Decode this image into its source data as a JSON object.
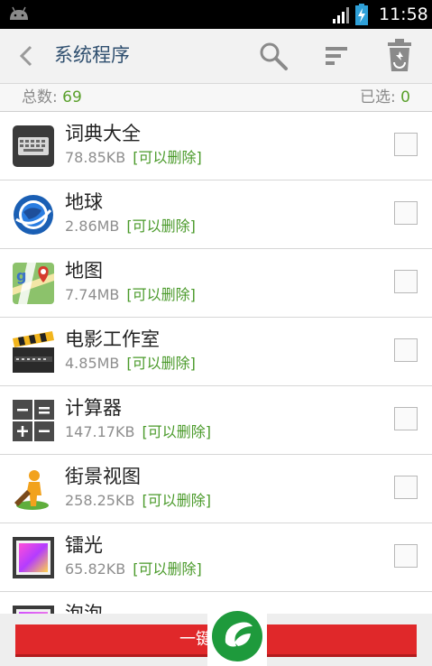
{
  "status_bar": {
    "time": "11:58",
    "left_icon": "android-icon",
    "signal_icon": "signal-icon",
    "battery_icon": "battery-charging-icon"
  },
  "header": {
    "title": "系统程序",
    "icons": [
      "back-icon",
      "search-icon",
      "sort-icon",
      "recycle-bin-icon"
    ]
  },
  "summary": {
    "total_label": "总数:",
    "total_value": "69",
    "selected_label": "已选:",
    "selected_value": "0"
  },
  "apps": [
    {
      "name": "词典大全",
      "size": "78.85KB",
      "tag": "[可以删除]",
      "icon": "keyboard-icon"
    },
    {
      "name": "地球",
      "size": "2.86MB",
      "tag": "[可以删除]",
      "icon": "google-earth-icon"
    },
    {
      "name": "地图",
      "size": "7.74MB",
      "tag": "[可以删除]",
      "icon": "maps-icon"
    },
    {
      "name": "电影工作室",
      "size": "4.85MB",
      "tag": "[可以删除]",
      "icon": "clapperboard-icon"
    },
    {
      "name": "计算器",
      "size": "147.17KB",
      "tag": "[可以删除]",
      "icon": "calculator-icon"
    },
    {
      "name": "街景视图",
      "size": "258.25KB",
      "tag": "[可以删除]",
      "icon": "street-view-icon"
    },
    {
      "name": "镭光",
      "size": "65.82KB",
      "tag": "[可以删除]",
      "icon": "gallery-icon"
    },
    {
      "name": "泡泡",
      "size": "",
      "tag": "",
      "icon": "gallery-icon"
    }
  ],
  "bottom": {
    "button_label": "一键",
    "watermark_icon": "leaf-logo-icon"
  },
  "colors": {
    "action_bar": "#f2f2f2",
    "accent_green": "#5aa02c",
    "button_red": "#e0282a",
    "title_text": "#2f4f6f"
  }
}
